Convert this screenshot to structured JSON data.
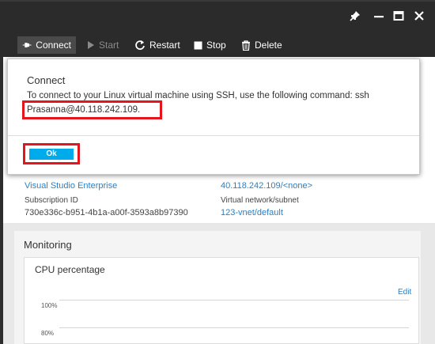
{
  "toolbar": {
    "connect_label": "Connect",
    "start_label": "Start",
    "restart_label": "Restart",
    "stop_label": "Stop",
    "delete_label": "Delete"
  },
  "essentials": {
    "subscription_name": "Visual Studio Enterprise",
    "public_ip": "40.118.242.109/<none>",
    "subscription_id_label": "Subscription ID",
    "subscription_id": "730e336c-b951-4b1a-a00f-3593a8b97390",
    "vnet_label": "Virtual network/subnet",
    "vnet_value": "123-vnet/default"
  },
  "monitoring": {
    "title": "Monitoring",
    "chart_title": "CPU percentage",
    "edit_label": "Edit",
    "ticks": [
      "100%",
      "80%"
    ]
  },
  "dialog": {
    "title": "Connect",
    "message": "To connect to your Linux virtual machine using SSH, use the following command: ssh",
    "address": "Prasanna@40.118.242.109.",
    "ok_label": "Ok"
  },
  "colors": {
    "accent": "#00abec",
    "highlight": "#e4151d",
    "link": "#2a7fc5",
    "chrome": "#2b2b2b"
  }
}
